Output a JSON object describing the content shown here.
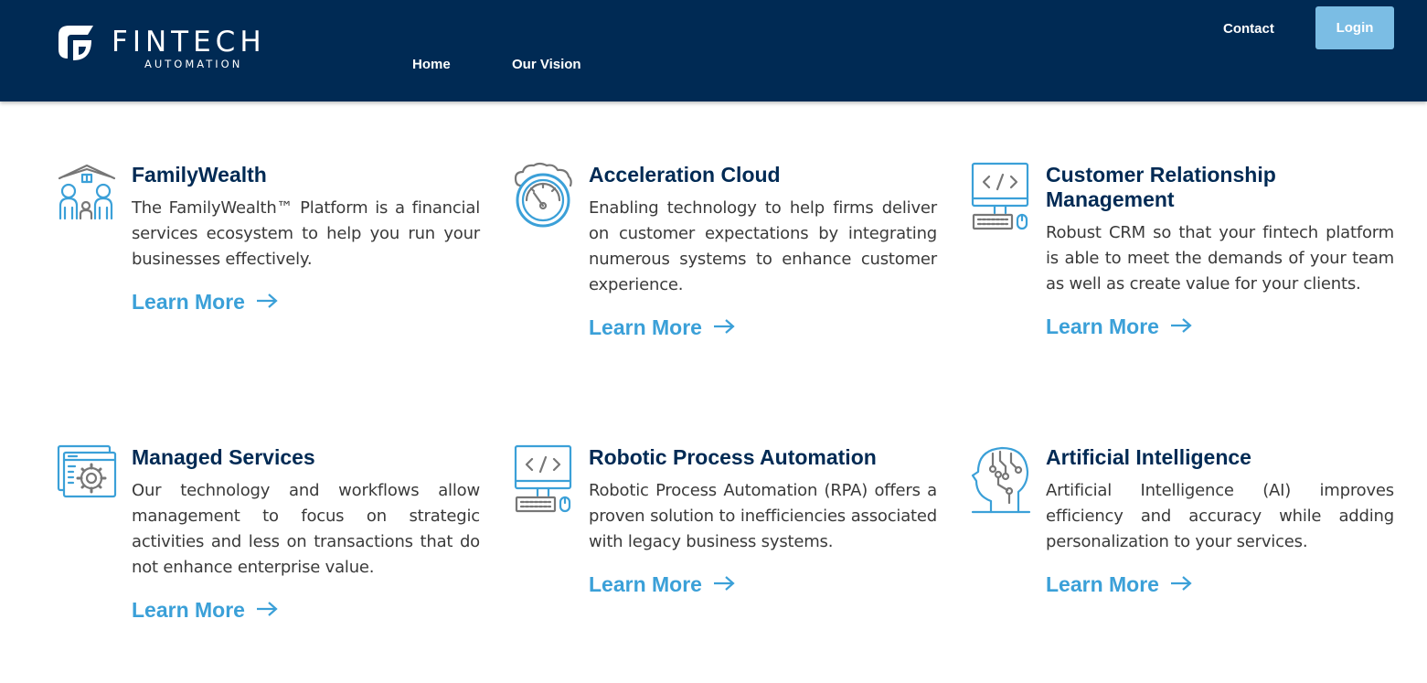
{
  "header": {
    "logo_word": "FINTECH",
    "logo_sub": "AUTOMATION",
    "nav": {
      "home": "Home",
      "vision": "Our Vision",
      "contact": "Contact"
    },
    "login_label": "Login"
  },
  "colors": {
    "header_bg": "#002a54",
    "accent": "#3ba0d8",
    "login_bg": "#7bbde4",
    "title": "#002a54"
  },
  "cards": [
    {
      "icon": "family-icon",
      "title": "FamilyWealth",
      "description": "The FamilyWealth™ Platform is a financial services ecosystem to help you run your businesses effectively.",
      "link": "Learn More"
    },
    {
      "icon": "speedometer-cloud-icon",
      "title": "Acceleration Cloud",
      "description": "Enabling technology to help firms deliver on customer expectations by integrating numerous systems to enhance customer experience.",
      "link": "Learn More"
    },
    {
      "icon": "code-monitor-icon",
      "title": "Customer Relationship Management",
      "description": "Robust CRM so that your fintech platform is able to meet the demands of your team as well as create value for your clients.",
      "link": "Learn More"
    },
    {
      "icon": "gear-window-icon",
      "title": "Managed Services",
      "description": "Our technology and workflows allow management to focus on strategic activities and less on transactions that do not enhance enterprise value.",
      "link": "Learn More"
    },
    {
      "icon": "code-monitor-icon",
      "title": "Robotic Process Automation",
      "description": "Robotic Process Automation (RPA) offers a proven solution to inefficiencies associated with legacy business systems.",
      "link": "Learn More"
    },
    {
      "icon": "ai-head-icon",
      "title": "Artificial Intelligence",
      "description": "Artificial Intelligence (AI) improves efficiency and accuracy while adding personalization to your services.",
      "link": "Learn More"
    }
  ]
}
